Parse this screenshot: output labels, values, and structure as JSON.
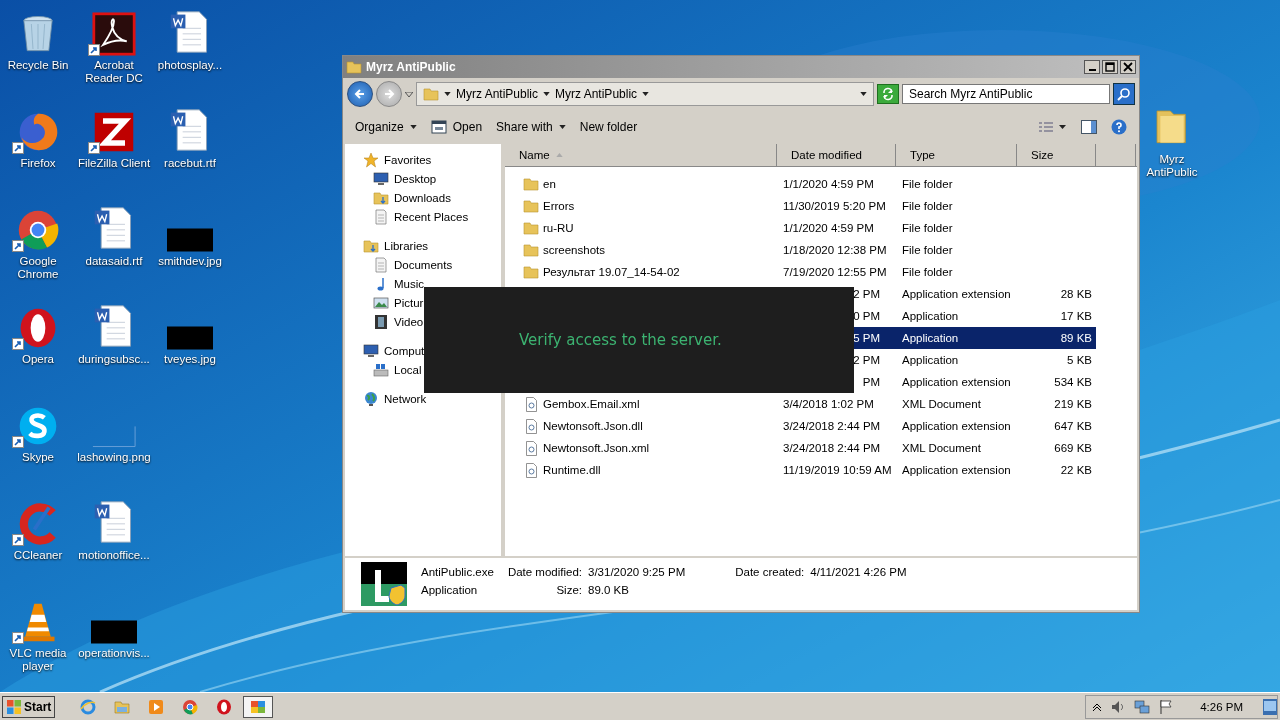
{
  "desktop": {
    "columns": [
      [
        {
          "label": "Recycle Bin",
          "kind": "recycle",
          "shortcut": false
        },
        {
          "label": "Firefox",
          "kind": "firefox",
          "shortcut": true
        },
        {
          "label": "Google Chrome",
          "kind": "chrome",
          "shortcut": true
        },
        {
          "label": "Opera",
          "kind": "opera",
          "shortcut": true
        },
        {
          "label": "Skype",
          "kind": "skype",
          "shortcut": true
        },
        {
          "label": "CCleaner",
          "kind": "ccleaner",
          "shortcut": true
        },
        {
          "label": "VLC media player",
          "kind": "vlc",
          "shortcut": true
        }
      ],
      [
        {
          "label": "Acrobat Reader DC",
          "kind": "acrobat",
          "shortcut": true
        },
        {
          "label": "FileZilla Client",
          "kind": "filezilla",
          "shortcut": true
        },
        {
          "label": "datasaid.rtf",
          "kind": "document",
          "shortcut": false
        },
        {
          "label": "duringsubsc...",
          "kind": "document",
          "shortcut": false
        },
        {
          "label": "lashowing.png",
          "kind": "blank",
          "shortcut": false
        },
        {
          "label": "motionoffice...",
          "kind": "document",
          "shortcut": false
        },
        {
          "label": "operationvis...",
          "kind": "black",
          "shortcut": false
        }
      ],
      [
        {
          "label": "photosplay...",
          "kind": "document",
          "shortcut": false
        },
        {
          "label": "racebut.rtf",
          "kind": "document",
          "shortcut": false
        },
        {
          "label": "smithdev.jpg",
          "kind": "black",
          "shortcut": false
        },
        {
          "label": "tveyes.jpg",
          "kind": "black",
          "shortcut": false
        }
      ]
    ],
    "side_icon": {
      "label": "Myrz AntiPublic",
      "kind": "folder"
    }
  },
  "window": {
    "title": "Myrz AntiPublic",
    "breadcrumbs": [
      "Myrz AntiPublic",
      "Myrz AntiPublic"
    ],
    "search": {
      "placeholder": "Search Myrz AntiPublic"
    },
    "toolbar": [
      {
        "label": "Organize",
        "kind": "menu"
      },
      {
        "label": "Open",
        "kind": "open"
      },
      {
        "label": "Share with",
        "kind": "menu"
      },
      {
        "label": "New folder",
        "kind": "plain"
      }
    ],
    "nav": [
      {
        "label": "Favorites",
        "kind": "star",
        "children": [
          {
            "label": "Desktop",
            "kind": "desktop"
          },
          {
            "label": "Downloads",
            "kind": "downloads"
          },
          {
            "label": "Recent Places",
            "kind": "recent"
          }
        ]
      },
      {
        "label": "Libraries",
        "kind": "libraries",
        "children": [
          {
            "label": "Documents",
            "kind": "documents"
          },
          {
            "label": "Music",
            "kind": "music"
          },
          {
            "label": "Pictur",
            "kind": "pictures"
          },
          {
            "label": "Video",
            "kind": "videos"
          }
        ]
      },
      {
        "label": "Comput",
        "kind": "computer",
        "children": [
          {
            "label": "Local",
            "kind": "disk"
          }
        ]
      },
      {
        "label": "Network",
        "kind": "network"
      }
    ],
    "columns": [
      "Name",
      "Date modified",
      "Type",
      "Size"
    ],
    "rows": [
      {
        "kind": "folder",
        "name": "en",
        "date": "1/1/2020 4:59 PM",
        "type": "File folder",
        "selected": false
      },
      {
        "kind": "folder",
        "name": "Errors",
        "date": "11/30/2019 5:20 PM",
        "type": "File folder",
        "selected": false
      },
      {
        "kind": "folder",
        "name": "ru-RU",
        "date": "1/1/2020 4:59 PM",
        "type": "File folder",
        "selected": false
      },
      {
        "kind": "folder",
        "name": "screenshots",
        "date": "1/18/2020 12:38 PM",
        "type": "File folder",
        "selected": false
      },
      {
        "kind": "folder",
        "name": "Результат 19.07_14-54-02",
        "date": "7/19/2020 12:55 PM",
        "type": "File folder",
        "selected": false
      },
      {
        "kind": "covered",
        "date": "2 PM",
        "type": "Application extension",
        "size": "28 KB",
        "selected": false
      },
      {
        "kind": "covered",
        "date": "0 PM",
        "type": "Application",
        "size": "17 KB",
        "selected": false
      },
      {
        "kind": "covered",
        "date": "5 PM",
        "type": "Application",
        "size": "89 KB",
        "selected": true
      },
      {
        "kind": "covered",
        "date": "2 PM",
        "type": "Application",
        "size": "5 KB",
        "selected": false
      },
      {
        "kind": "covered",
        "date": "PM",
        "type": "Application extension",
        "size": "534 KB",
        "selected": false
      },
      {
        "kind": "xml",
        "name": "Gembox.Email.xml",
        "date": "3/4/2018 1:02 PM",
        "type": "XML Document",
        "size": "219 KB",
        "selected": false
      },
      {
        "kind": "dll",
        "name": "Newtonsoft.Json.dll",
        "date": "3/24/2018 2:44 PM",
        "type": "Application extension",
        "size": "647 KB",
        "selected": false
      },
      {
        "kind": "xml",
        "name": "Newtonsoft.Json.xml",
        "date": "3/24/2018 2:44 PM",
        "type": "XML Document",
        "size": "669 KB",
        "selected": false
      },
      {
        "kind": "dll",
        "name": "Runtime.dll",
        "date": "11/19/2019 10:59 AM",
        "type": "Application extension",
        "size": "22 KB",
        "selected": false
      }
    ],
    "details": {
      "name": "AntiPublic.exe",
      "type": "Application",
      "modified_label": "Date modified:",
      "modified": "3/31/2020 9:25 PM",
      "size_label": "Size:",
      "size": "89.0 KB",
      "created_label": "Date created:",
      "created": "4/11/2021 4:26 PM"
    }
  },
  "popup": {
    "message": "Verify access to the server."
  },
  "taskbar": {
    "start": "Start",
    "apps": [
      {
        "kind": "ie",
        "selected": false
      },
      {
        "kind": "explorer",
        "selected": false
      },
      {
        "kind": "player",
        "selected": false
      },
      {
        "kind": "chrome",
        "selected": false
      },
      {
        "kind": "opera",
        "selected": false
      },
      {
        "kind": "app",
        "selected": true
      }
    ],
    "time": "4:26 PM"
  }
}
